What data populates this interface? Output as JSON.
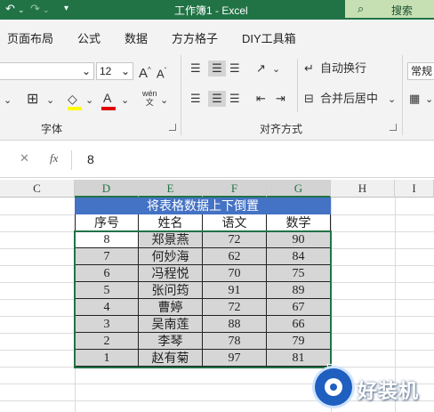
{
  "titlebar": {
    "title": "工作簿1  -  Excel",
    "search_label": "搜索",
    "icons": [
      "undo-icon",
      "redo-icon",
      "customize-icon",
      "search-icon"
    ]
  },
  "tabs": [
    "页面布局",
    "公式",
    "数据",
    "方方格子",
    "DIY工具箱"
  ],
  "ribbon": {
    "font_size": "12",
    "grow_font": "A",
    "shrink_font": "A",
    "font_color_label": "A",
    "phonetic": "wén\n文",
    "wrap_text": "自动换行",
    "merge_center": "合并后居中",
    "number_format": "常规",
    "group_font": "字体",
    "group_align": "对齐方式"
  },
  "formula_bar": {
    "value": "8",
    "fx": "fx"
  },
  "grid": {
    "columns": [
      "C",
      "D",
      "E",
      "F",
      "G",
      "H",
      "I"
    ],
    "table_title": "将表格数据上下倒置",
    "headers": [
      "序号",
      "姓名",
      "语文",
      "数学"
    ],
    "rows": [
      [
        "8",
        "郑景燕",
        "72",
        "90"
      ],
      [
        "7",
        "何妙海",
        "62",
        "84"
      ],
      [
        "6",
        "冯程悦",
        "70",
        "75"
      ],
      [
        "5",
        "张问筠",
        "91",
        "89"
      ],
      [
        "4",
        "曹婷",
        "72",
        "67"
      ],
      [
        "3",
        "吴南莲",
        "88",
        "66"
      ],
      [
        "2",
        "李琴",
        "78",
        "79"
      ],
      [
        "1",
        "赵有菊",
        "97",
        "81"
      ]
    ]
  },
  "watermark": {
    "text": "好装机"
  },
  "colors": {
    "excel_green": "#217346",
    "title_blue": "#4472c4",
    "cell_grey": "#d6d6d6"
  }
}
